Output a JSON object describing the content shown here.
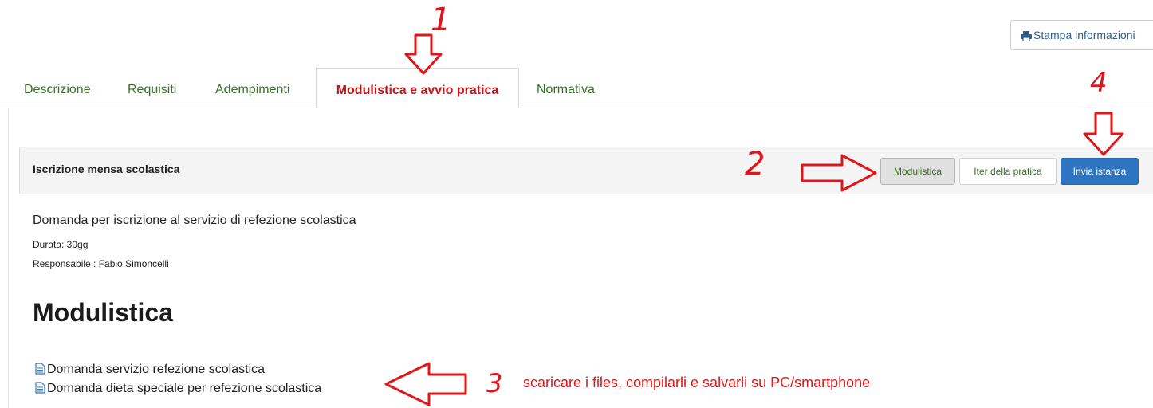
{
  "print_button": {
    "label": "Stampa informazioni",
    "icon": "print-icon"
  },
  "tabs": [
    {
      "label": "Descrizione",
      "active": false
    },
    {
      "label": "Requisiti",
      "active": false
    },
    {
      "label": "Adempimenti",
      "active": false
    },
    {
      "label": "Modulistica e avvio pratica",
      "active": true
    },
    {
      "label": "Normativa",
      "active": false
    }
  ],
  "panel": {
    "title": "Iscrizione mensa scolastica",
    "buttons": {
      "modulistica": "Modulistica",
      "iter": "Iter della pratica",
      "invia": "Invia istanza"
    }
  },
  "details": {
    "description": "Domanda per iscrizione al servizio di refezione scolastica",
    "duration": "Durata: 30gg",
    "responsible": "Responsabile : Fabio Simoncelli"
  },
  "modulistica": {
    "heading": "Modulistica",
    "documents": [
      {
        "label": "Domanda servizio refezione scolastica",
        "icon": "document-icon"
      },
      {
        "label": "Domanda dieta speciale per refezione scolastica",
        "icon": "document-icon"
      }
    ]
  },
  "annotations": {
    "colors": {
      "annotation": "#e0161a",
      "link_green": "#3a6e2a",
      "primary_blue": "#2f74c0"
    },
    "step1": "1",
    "step2": "2",
    "step3": "3",
    "step4": "4",
    "step3_text": "scaricare i files, compilarli e salvarli su PC/smartphone"
  }
}
